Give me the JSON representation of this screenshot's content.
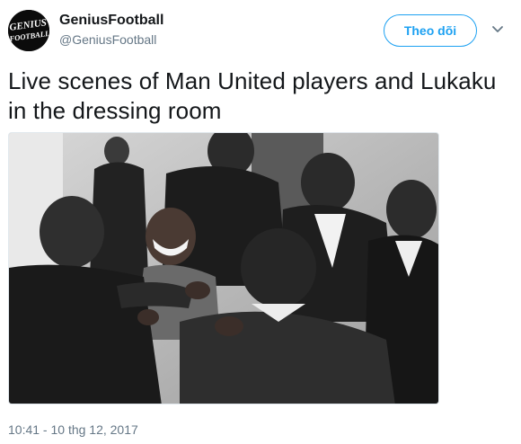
{
  "header": {
    "display_name": "GeniusFootball",
    "handle": "@GeniusFootball",
    "follow_label": "Theo dõi",
    "avatar_logo_text": [
      "GENIUS",
      "FOOTBALL"
    ]
  },
  "tweet": {
    "text_line1": "Live scenes of Man United players and Lukaku",
    "text_line2": "in the dressing room",
    "timestamp": "10:41 - 10 thg 12, 2017"
  },
  "colors": {
    "accent": "#1da1f2",
    "secondary_text": "#657786",
    "primary_text": "#14171a"
  },
  "icons": {
    "caret": "chevron-down-icon"
  }
}
